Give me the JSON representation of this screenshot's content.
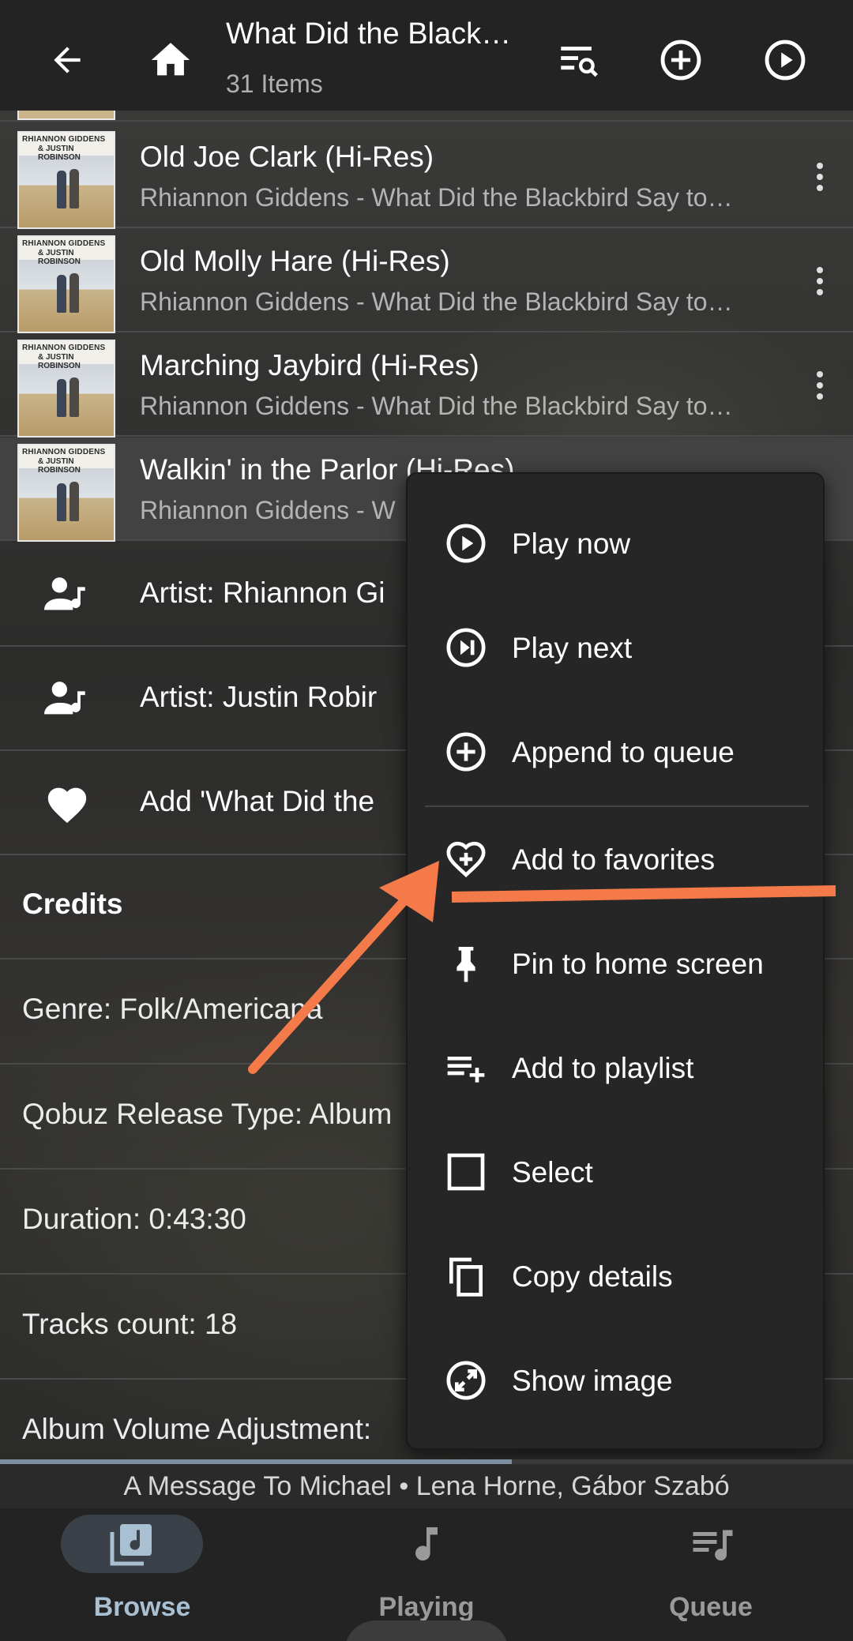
{
  "app_bar": {
    "title": "What Did the Black…",
    "subtitle": "31 Items",
    "icons": [
      "back-arrow-icon",
      "home-icon",
      "filter-search-icon",
      "add-circle-icon",
      "play-circle-icon"
    ]
  },
  "tracks": [
    {
      "title": "Old Joe Clark (Hi-Res)",
      "subtitle": "Rhiannon Giddens - What Did the Blackbird Say to…",
      "cover_line1": "RHIANNON GIDDENS",
      "cover_line2": "& JUSTIN ROBINSON"
    },
    {
      "title": "Old Molly Hare (Hi-Res)",
      "subtitle": "Rhiannon Giddens - What Did the Blackbird Say to…",
      "cover_line1": "RHIANNON GIDDENS",
      "cover_line2": "& JUSTIN ROBINSON"
    },
    {
      "title": "Marching Jaybird (Hi-Res)",
      "subtitle": "Rhiannon Giddens - What Did the Blackbird Say to…",
      "cover_line1": "RHIANNON GIDDENS",
      "cover_line2": "& JUSTIN ROBINSON"
    },
    {
      "title": "Walkin' in the Parlor (Hi-Res)",
      "subtitle": "Rhiannon Giddens - W",
      "cover_line1": "RHIANNON GIDDENS",
      "cover_line2": "& JUSTIN ROBINSON"
    }
  ],
  "artist_rows": [
    {
      "label": "Artist: Rhiannon Gi"
    },
    {
      "label": "Artist: Justin Robir"
    }
  ],
  "favorite_row": {
    "label": "Add 'What Did the"
  },
  "info_rows": [
    {
      "label": "Credits"
    },
    {
      "label": "Genre: Folk/Americana"
    },
    {
      "label": "Qobuz Release Type: Album"
    },
    {
      "label": "Duration: 0:43:30"
    },
    {
      "label": "Tracks count: 18"
    },
    {
      "label": "Album Volume Adjustment:"
    }
  ],
  "menu": {
    "items": [
      {
        "label": "Play now",
        "icon": "play-circle-icon"
      },
      {
        "label": "Play next",
        "icon": "skip-next-circle-icon"
      },
      {
        "label": "Append to queue",
        "icon": "add-circle-icon"
      },
      {
        "label": "Add to favorites",
        "icon": "heart-plus-icon"
      },
      {
        "label": "Pin to home screen",
        "icon": "pin-icon"
      },
      {
        "label": "Add to playlist",
        "icon": "playlist-add-icon"
      },
      {
        "label": "Select",
        "icon": "checkbox-icon"
      },
      {
        "label": "Copy details",
        "icon": "copy-icon"
      },
      {
        "label": "Show image",
        "icon": "expand-image-icon"
      }
    ]
  },
  "player": {
    "progress": 0.6,
    "now_playing": "A Message To Michael • Lena Horne, Gábor Szabó"
  },
  "bottom_nav": {
    "items": [
      {
        "label": "Browse",
        "icon": "album-icon",
        "active": true
      },
      {
        "label": "Playing",
        "icon": "music-note-icon",
        "active": false
      },
      {
        "label": "Queue",
        "icon": "queue-music-icon",
        "active": false
      }
    ]
  },
  "colors": {
    "annotation_orange": "#f47a4a",
    "nav_active": "#a9bfd2",
    "nav_inactive": "#9a9a9a",
    "progress": "#7a8ea0"
  }
}
